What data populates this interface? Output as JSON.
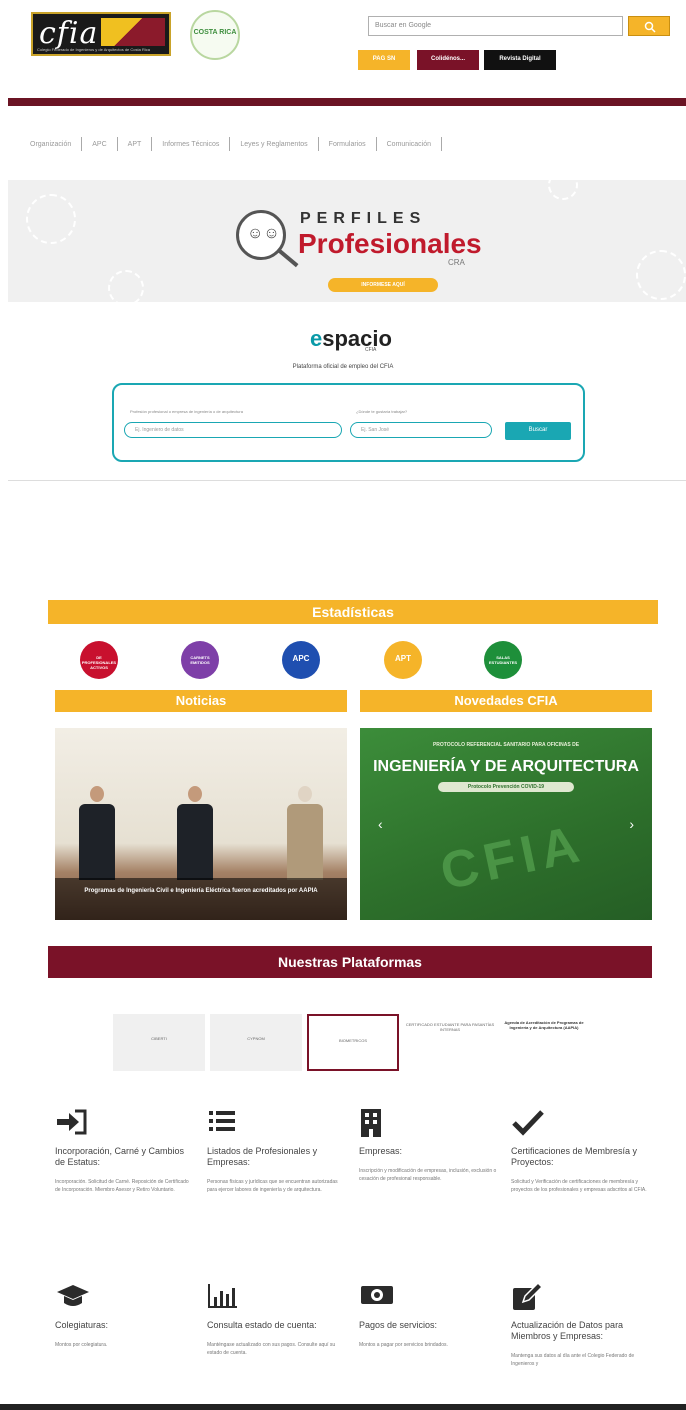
{
  "header": {
    "search_placeholder": "Buscar en Google",
    "btn1": "PAG SN",
    "btn2": "Colidénos...",
    "btn3": "Revista Digital",
    "logo_text": "cfia",
    "logo_sub": "Colegio Federado de Ingenieros y de Arquitectos de Costa Rica",
    "seal_text": "COSTA RICA"
  },
  "nav": {
    "items": [
      "Organización",
      "APC",
      "APT",
      "Informes Técnicos",
      "Leyes y Reglamentos",
      "Formularios",
      "Comunicación"
    ]
  },
  "banner": {
    "perfiles": "PERFILES",
    "profesionales": "Profesionales",
    "cra": "CRA",
    "button": "INFORMESE AQUÍ"
  },
  "espacio": {
    "logo_e": "e",
    "logo_rest": "spacio",
    "logo_sub": "CFIA",
    "tagline": "Plataforma oficial de empleo del CFIA",
    "label1": "Profesión profesional o empresa de ingeniería o de arquitectura",
    "placeholder1": "Ej. Ingeniero de datos",
    "label2": "¿Dónde te gustaría trabajar?",
    "placeholder2": "Ej. San José",
    "button": "Buscar"
  },
  "stats": {
    "title": "Estadísticas",
    "items": [
      {
        "label": "DE PROFESIONALES ACTIVOS",
        "color": "#c8102e"
      },
      {
        "label": "CARNETS EMITIDOS",
        "color": "#7e3fa8"
      },
      {
        "label": "APC",
        "color": "#1f4fb0"
      },
      {
        "label": "APT",
        "color": "#f5b429"
      },
      {
        "label": "SALAS ESTUDIANTES",
        "color": "#1e8f3a"
      }
    ]
  },
  "sections": {
    "noticias": "Noticias",
    "novedades": "Novedades CFIA"
  },
  "news": {
    "caption": "Programas de Ingeniería Civil e Ingeniería Eléctrica fueron acreditados por AAPIA"
  },
  "novedades": {
    "top": "PROTOCOLO REFERENCIAL SANITARIO PARA OFICINAS DE",
    "big": "INGENIERÍA Y DE ARQUITECTURA",
    "pill": "Protocolo Prevención COVID-19",
    "watermark": "CFIA",
    "prev": "‹",
    "next": "›"
  },
  "plataformas": {
    "title": "Nuestras Plataformas",
    "tiles": [
      "CIBERTI",
      "CYPNOM",
      "BIOMETRICOS",
      "CERTIFICADO ESTUDIANTE PARA PASANTÍAS INTERNAS",
      "Agenda de Acreditación de Programas de Ingeniería y de Arquitectura (AAPIA)"
    ]
  },
  "services": [
    {
      "icon": "sign-in-icon",
      "title": "Incorporación, Carné y Cambios de Estatus:",
      "desc": "Incorporación. Solicitud de Carné. Reposición de Certificado de Incorporación. Miembro Asesor y Retiro Voluntario."
    },
    {
      "icon": "list-icon",
      "title": "Listados de Profesionales y Empresas:",
      "desc": "Personas físicas y jurídicas que se encuentran autorizadas para ejercer labores de ingeniería y de arquitectura."
    },
    {
      "icon": "building-icon",
      "title": "Empresas:",
      "desc": "Inscripción y modificación de empresas, inclusión, exclusión o cesación de profesional responsable."
    },
    {
      "icon": "check-icon",
      "title": "Certificaciones de Membresía y Proyectos:",
      "desc": "Solicitud y Verificación de certificaciones de membresía y proyectos de los profesionales y empresas adscritos al CFIA."
    },
    {
      "icon": "graduation-cap-icon",
      "title": "Colegiaturas:",
      "desc": "Montos por colegiatura."
    },
    {
      "icon": "bar-chart-icon",
      "title": "Consulta estado de cuenta:",
      "desc": "Manténgase actualizado con sus pagos. Consulte aquí su estado de cuenta."
    },
    {
      "icon": "money-icon",
      "title": "Pagos de servicios:",
      "desc": "Montos a pagar por servicios brindados."
    },
    {
      "icon": "edit-icon",
      "title": "Actualización de Datos para Miembros y Empresas:",
      "desc": "Mantenga sus datos al día ante el Colegio Federado de Ingenieros y"
    }
  ]
}
